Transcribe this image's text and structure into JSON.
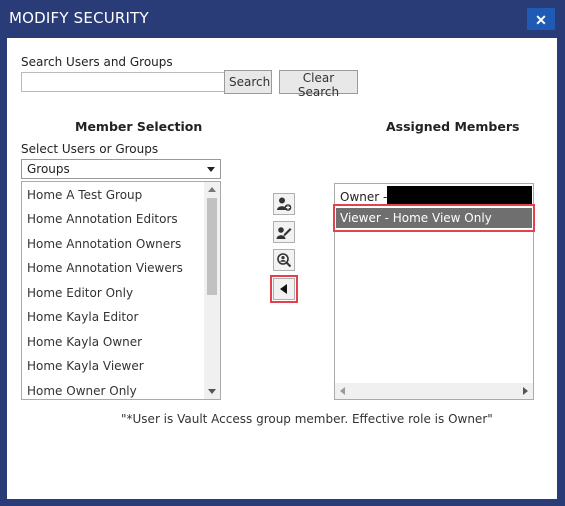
{
  "dialog": {
    "title": "MODIFY SECURITY",
    "close_label": "✕"
  },
  "search": {
    "label": "Search Users and Groups",
    "value": "",
    "placeholder": "",
    "search_button": "Search",
    "clear_button": "Clear Search"
  },
  "member_selection": {
    "heading": "Member Selection",
    "select_label": "Select Users or Groups",
    "selected_type": "Groups",
    "items": [
      "Home A Test Group",
      "Home Annotation Editors",
      "Home Annotation Owners",
      "Home Annotation Viewers",
      "Home Editor Only",
      "Home Kayla Editor",
      "Home Kayla Owner",
      "Home Kayla Viewer",
      "Home Owner Only"
    ]
  },
  "actions": {
    "icons": [
      "add-user-icon",
      "edit-user-icon",
      "search-user-icon",
      "remove-left-arrow-icon"
    ]
  },
  "assigned_members": {
    "heading": "Assigned Members",
    "items": [
      {
        "label": "Owner -"
      },
      {
        "label": "Viewer - Home View Only"
      }
    ]
  },
  "footnote": "\"*User is Vault Access group member. Effective role is Owner\"",
  "colors": {
    "titlebar": "#2a3c78",
    "close_button": "#1f5bb5",
    "selected_row": "#6f6f6f",
    "highlight": "#e0434d"
  }
}
